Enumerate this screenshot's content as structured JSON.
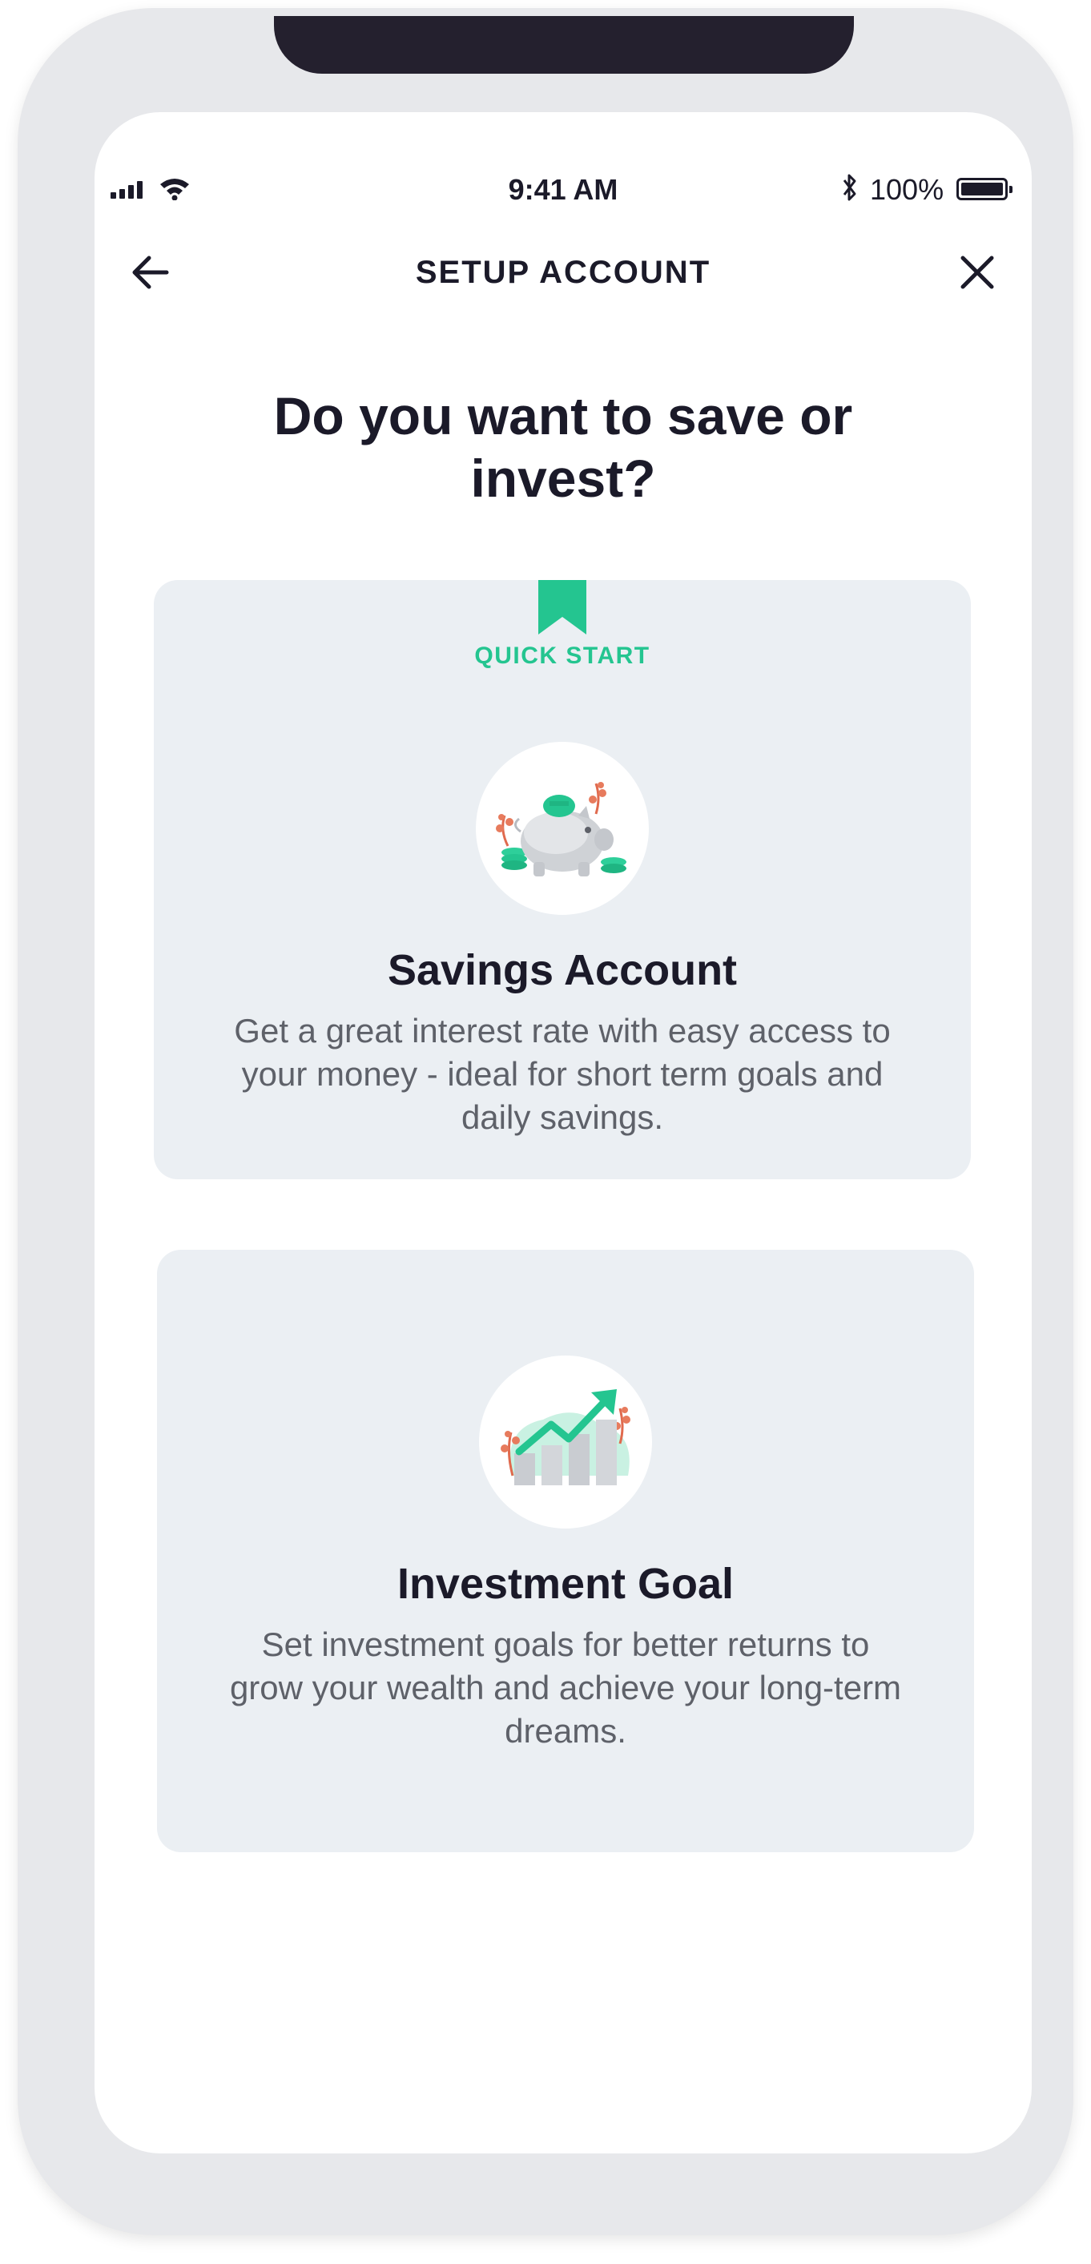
{
  "status_bar": {
    "time": "9:41 AM",
    "battery_percent": "100%",
    "icons": [
      "signal-icon",
      "wifi-icon",
      "bluetooth-icon",
      "battery-icon"
    ]
  },
  "header": {
    "title": "SETUP ACCOUNT",
    "back_icon": "arrow-left-icon",
    "close_icon": "close-icon"
  },
  "question": "Do you want to save or invest?",
  "options": [
    {
      "badge": "QUICK START",
      "title": "Savings Account",
      "description": "Get a great interest rate with easy access to your money - ideal for short term goals and daily savings.",
      "illustration": "piggy-bank-illustration"
    },
    {
      "title": "Investment Goal",
      "description": "Set investment goals for better returns to grow your wealth and achieve your long-term dreams.",
      "illustration": "growth-chart-illustration"
    }
  ],
  "colors": {
    "accent": "#24c590",
    "text_dark": "#1b1a29",
    "text_muted": "#5e6169",
    "card_bg": "#ebeff3"
  }
}
